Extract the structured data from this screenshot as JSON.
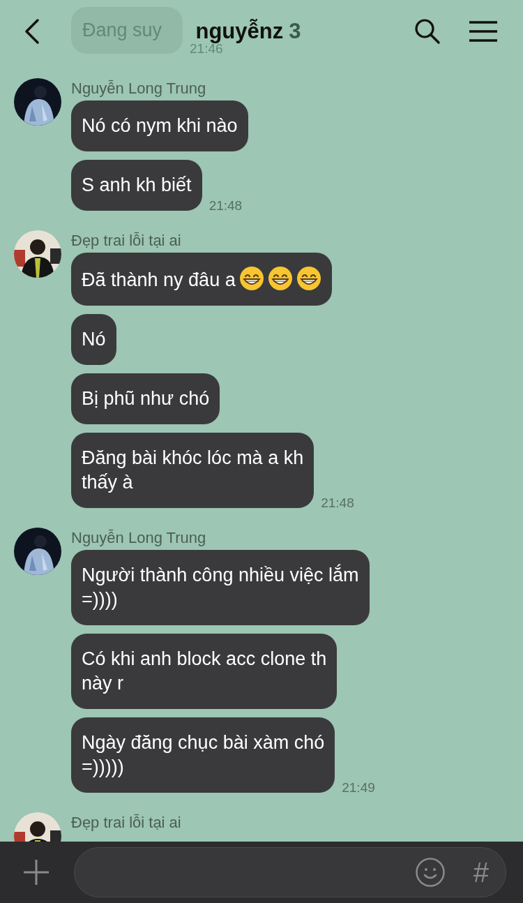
{
  "header": {
    "title": "nguyễnz",
    "member_count": "3",
    "ghost_message": {
      "text": "Đang suy",
      "time": "21:46"
    }
  },
  "groups": [
    {
      "sender": "Nguyễn Long Trung",
      "messages": [
        {
          "lines": [
            "Nó có nym khi nào"
          ]
        },
        {
          "lines": [
            "S anh kh biết"
          ]
        }
      ],
      "time": "21:48"
    },
    {
      "sender": "Đẹp trai lỗi tại ai",
      "messages": [
        {
          "lines": [
            "Đã thành ny đâu a"
          ],
          "emojis": [
            {
              "kind": "grin"
            },
            {
              "kind": "grin"
            },
            {
              "kind": "grin"
            }
          ]
        },
        {
          "lines": [
            "Nó"
          ]
        },
        {
          "lines": [
            "Bị phũ như chó"
          ]
        },
        {
          "lines": [
            "Đăng bài khóc lóc mà a kh",
            "thấy à"
          ]
        }
      ],
      "time": "21:48"
    },
    {
      "sender": "Nguyễn Long Trung",
      "messages": [
        {
          "lines": [
            "Người thành công nhiều việc lắm",
            "=))))"
          ]
        },
        {
          "lines": [
            "Có khi anh block acc clone th",
            "này r"
          ]
        },
        {
          "lines": [
            "Ngày đăng chục bài xàm chó",
            "=)))))"
          ]
        }
      ],
      "time": "21:49"
    },
    {
      "sender": "Đẹp trai lỗi tại ai"
    }
  ],
  "composer": {
    "hash_key": "#"
  }
}
